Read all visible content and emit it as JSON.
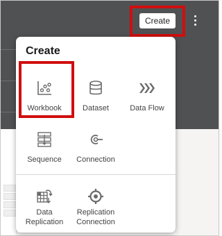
{
  "toolbar": {
    "create_label": "Create"
  },
  "menu": {
    "title": "Create",
    "items": [
      {
        "label": "Workbook",
        "icon": "workbook-icon"
      },
      {
        "label": "Dataset",
        "icon": "dataset-icon"
      },
      {
        "label": "Data Flow",
        "icon": "data-flow-icon"
      },
      {
        "label": "Sequence",
        "icon": "sequence-icon"
      },
      {
        "label": "Connection",
        "icon": "connection-icon"
      },
      {
        "label": "Data\nReplication",
        "icon": "data-replication-icon"
      },
      {
        "label": "Replication\nConnection",
        "icon": "replication-connection-icon"
      }
    ]
  },
  "colors": {
    "header": "#4f5153",
    "highlight": "#d00e0e",
    "icon": "#6b6b6b"
  }
}
